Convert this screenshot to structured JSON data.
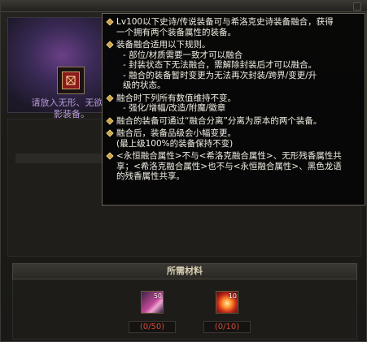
{
  "source_panel": {
    "hint_line1": "请放入无形、无欲、",
    "hint_line2": "影装备。"
  },
  "materials": {
    "header": "所需材料",
    "items": [
      {
        "count": "50",
        "qty": "(0/50)"
      },
      {
        "count": "10",
        "qty": "(0/10)"
      }
    ]
  },
  "tooltip": {
    "blocks": [
      [
        "Lv100以下史诗/传说装备可与希洛克史诗装备融合，获得",
        "一个拥有两个装备属性的装备。"
      ],
      [
        "装备融合适用以下规则。",
        "- 部位/材质需要一致才可以融合",
        "- 封装状态下无法融合，需解除封装后才可以融合。",
        "- 融合的装备暂时变更为无法再次封装/跨界/变更/升",
        "级的状态。"
      ],
      [
        "融合时下列所有数值维持不变。",
        "- 强化/增幅/改造/附魔/徽章"
      ],
      [
        "融合的装备可通过“融合分离”分离为原本的两个装备。"
      ],
      [
        "融合后，装备品级会小幅变更。",
        "(最上级100%的装备保持不变)"
      ],
      [
        "<永恒融合属性>不与<希洛克融合属性>、无形残香属性共",
        "享；<希洛克融合属性>也不与<永恒融合属性>、黑色龙语",
        "的残香属性共享。"
      ]
    ]
  },
  "colors": {
    "accent": "#c9a24a",
    "qty_red": "#d24a3a",
    "hint_purple": "#b79bd8"
  }
}
